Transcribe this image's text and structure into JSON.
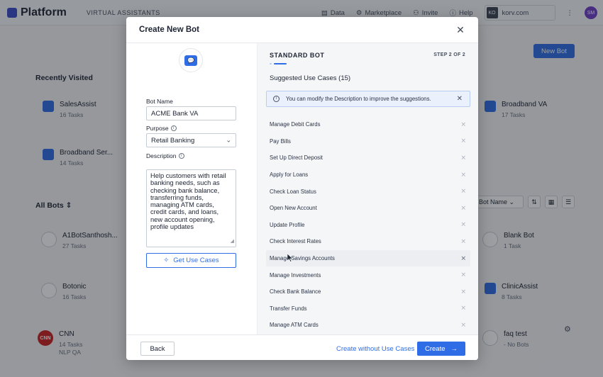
{
  "app": {
    "logo_text": "Platform",
    "section": "VIRTUAL ASSISTANTS",
    "nav": [
      {
        "label": "Data",
        "icon": "database-icon"
      },
      {
        "label": "Marketplace",
        "icon": "marketplace-icon"
      },
      {
        "label": "Invite",
        "icon": "invite-icon"
      },
      {
        "label": "Help",
        "icon": "help-icon"
      }
    ],
    "workspace_badge": "KO",
    "workspace_name": "korv.com",
    "avatar_initials": "SM",
    "new_bot_label": "New Bot",
    "recently_visited": "Recently Visited",
    "all_bots": "All Bots",
    "sort_label": "Bot Name",
    "recent_cards": [
      {
        "name": "SalesAssist",
        "sub": "16 Tasks"
      },
      {
        "name": "Broadband Ser...",
        "sub": "14 Tasks"
      },
      {
        "name": "Broadband VA",
        "sub": "17 Tasks"
      }
    ],
    "all_cards": [
      {
        "name": "A1BotSanthosh...",
        "sub": "27 Tasks"
      },
      {
        "name": "Botonic",
        "sub": "16 Tasks"
      },
      {
        "name": "CNN",
        "sub": "14 Tasks",
        "extra": "NLP QA",
        "logo": "CNN"
      },
      {
        "name": "Blank Bot",
        "sub": "1 Task"
      },
      {
        "name": "ClinicAssist",
        "sub": "8 Tasks"
      },
      {
        "name": "faq test",
        "sub": "- No Bots"
      }
    ]
  },
  "modal": {
    "title": "Create New Bot",
    "bot_name_label": "Bot Name",
    "bot_name_value": "ACME Bank VA",
    "purpose_label": "Purpose",
    "purpose_value": "Retail Banking",
    "description_label": "Description",
    "description_value": "Help customers with retail banking needs, such as checking bank balance, transferring funds, managing ATM cards, credit cards, and loans, new account opening, profile updates",
    "get_use_cases_label": "Get Use Cases",
    "standard_bot_title": "STANDARD BOT",
    "step_label": "STEP 2 OF 2",
    "suggested_title": "Suggested Use Cases (15)",
    "notice_text": "You can modify the Description to improve the suggestions.",
    "use_cases": [
      "Manage Debit Cards",
      "Pay Bills",
      "Set Up Direct Deposit",
      "Apply for Loans",
      "Check Loan Status",
      "Open New Account",
      "Update Profile",
      "Check Interest Rates",
      "Manage Savings Accounts",
      "Manage Investments",
      "Check Bank Balance",
      "Transfer Funds",
      "Manage ATM Cards"
    ],
    "back_label": "Back",
    "create_without_label": "Create without Use Cases",
    "create_label": "Create"
  }
}
